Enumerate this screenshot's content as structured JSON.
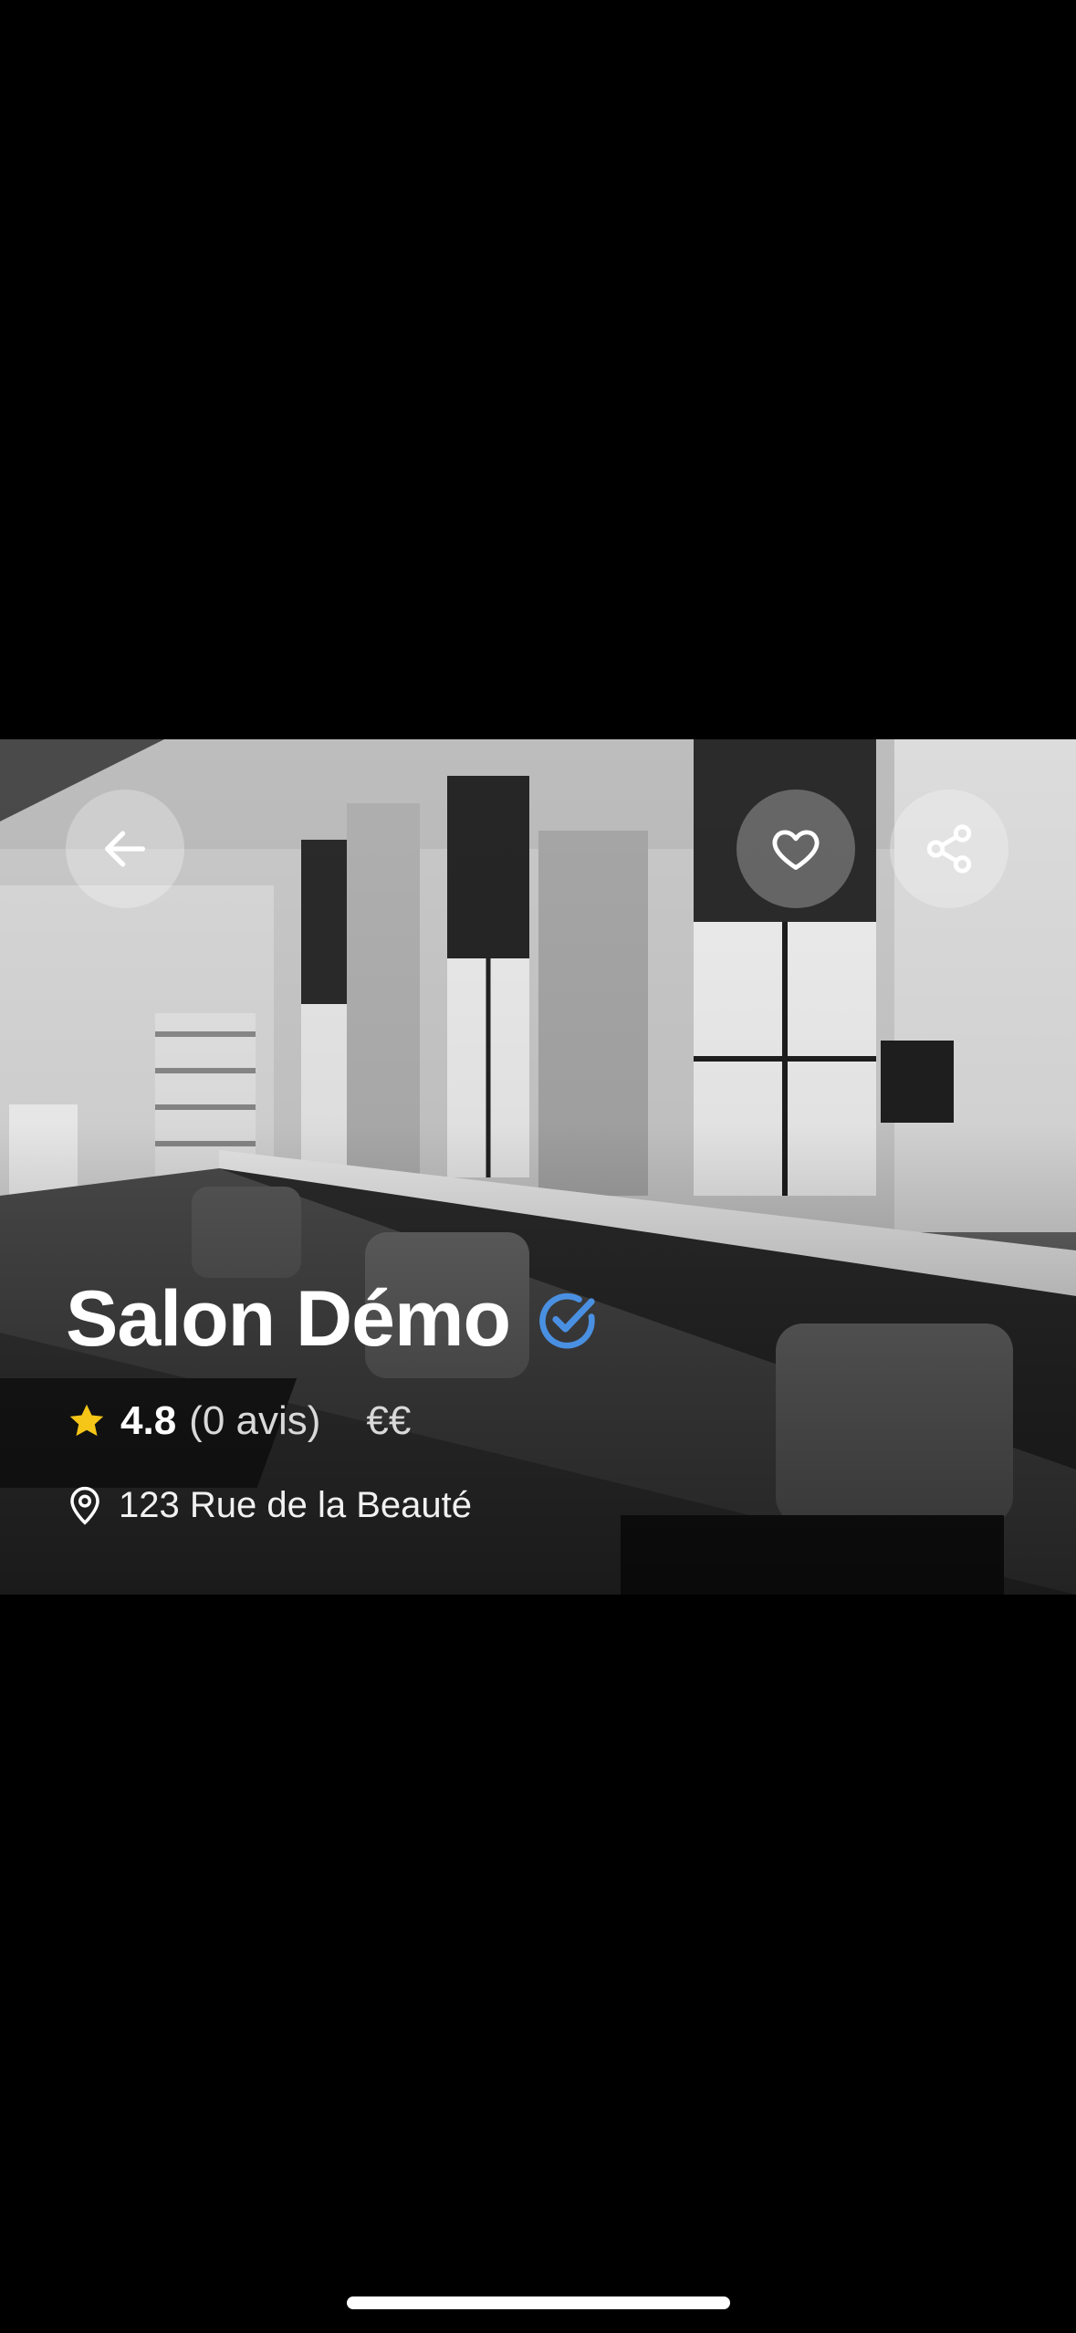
{
  "salon": {
    "name": "Salon Démo",
    "verified_icon": "verified-check-icon",
    "rating": "4.8",
    "reviews": "(0 avis)",
    "price_level": "€€",
    "address": "123 Rue de la Beauté"
  },
  "actions": {
    "back_icon": "arrow-left-icon",
    "favorite_icon": "heart-icon",
    "share_icon": "share-icon"
  },
  "colors": {
    "background": "#000000",
    "star": "#F5C518",
    "verified": "#4A90E2",
    "button_bg": "rgba(255,255,255,0.28)"
  }
}
